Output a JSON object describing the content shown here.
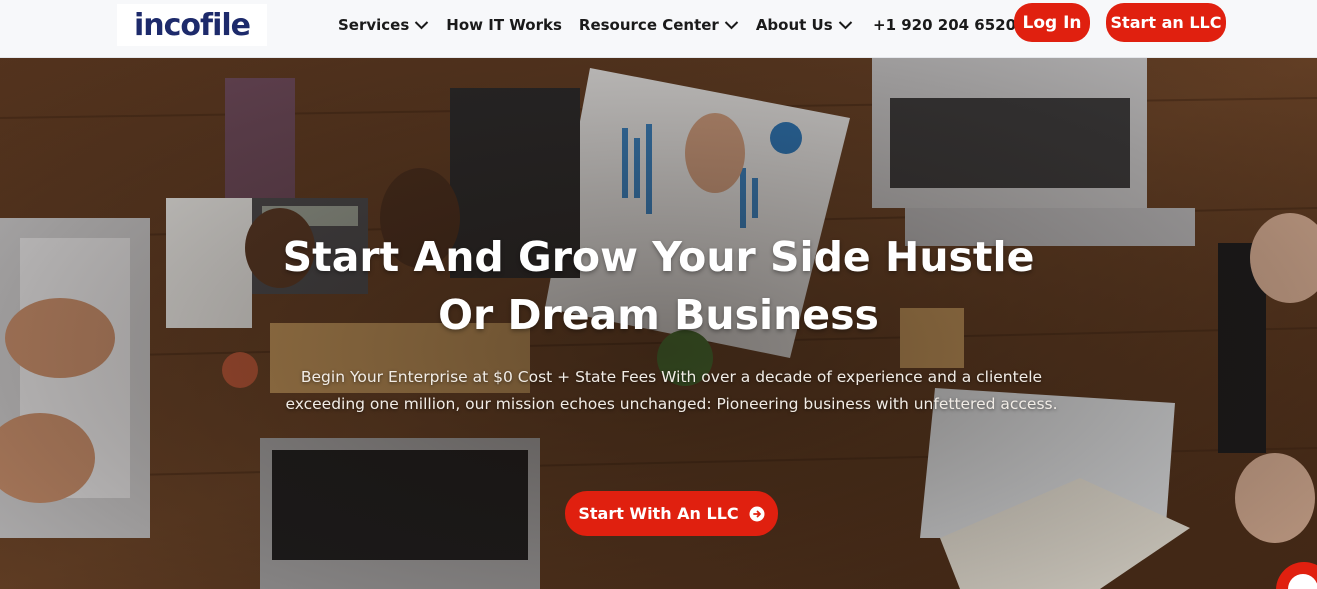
{
  "brand": {
    "logo_text": "incofile"
  },
  "nav": {
    "items": [
      {
        "label": "Services",
        "has_dropdown": true
      },
      {
        "label": "How IT Works",
        "has_dropdown": false
      },
      {
        "label": "Resource Center",
        "has_dropdown": true
      },
      {
        "label": "About Us",
        "has_dropdown": true
      }
    ],
    "phone": "+1 920 204 6520",
    "login_label": "Log In",
    "start_llc_label": "Start an LLC"
  },
  "hero": {
    "title_line1": "Start And Grow Your Side Hustle",
    "title_line2": "Or Dream Business",
    "subtitle": "Begin Your Enterprise at $0 Cost + State Fees With over a decade of experience and a clientele exceeding one million, our mission echoes unchanged: Pioneering business with unfettered access.",
    "cta_label": "Start With An LLC"
  },
  "colors": {
    "accent": "#e0200f",
    "logo_blue": "#1d2a6b",
    "nav_bg": "#f7f8fa",
    "text_dark": "#1a1a1a"
  },
  "icons": {
    "dropdown": "chevron-down-icon",
    "cta": "arrow-circle-right-icon",
    "chat": "chat-icon"
  }
}
